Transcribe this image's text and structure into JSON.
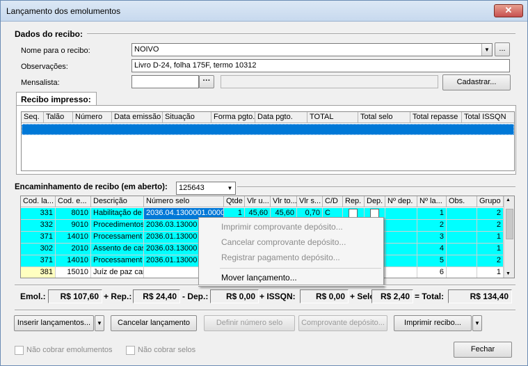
{
  "window": {
    "title": "Lançamento dos emolumentos",
    "close_glyph": "✕"
  },
  "dados": {
    "group_label": "Dados do recibo:",
    "nome_label": "Nome para o recibo:",
    "nome_value": "NOIVO",
    "nome_ellipsis": "...",
    "obs_label": "Observações:",
    "obs_value": "Livro D-24, folha 175F, termo 10312",
    "mensalista_label": "Mensalista:",
    "mensalista_value": "",
    "mensalista_ellipsis": "···",
    "mensalista_name": "",
    "cadastrar_label": "Cadastrar..."
  },
  "recibo_impresso": {
    "tab_label": "Recibo impresso:",
    "columns": [
      "Seq.",
      "Talão",
      "Número",
      "Data emissão",
      "Situação",
      "Forma pgto.",
      "Data pgto.",
      "TOTAL",
      "Total selo",
      "Total repasse",
      "Total ISSQN"
    ]
  },
  "encaminhamento": {
    "label": "Encaminhamento de recibo (em aberto):",
    "value": "125643",
    "columns": [
      "Cod. la...",
      "Cod. e...",
      "Descrição",
      "Número selo",
      "Qtde",
      "Vlr u...",
      "Vlr to...",
      "Vlr s...",
      "C/D",
      "Rep.",
      "Dep.",
      "Nº dep.",
      "Nº la...",
      "Obs.",
      "Grupo"
    ],
    "rows": [
      {
        "cod_la": "331",
        "cod_e": "8010",
        "desc": "Habilitação de",
        "selo": "2036.04.1300001.0000",
        "qtde": "1",
        "vlr_u": "45,60",
        "vlr_to": "45,60",
        "vlr_s": "0,70",
        "cd": "C",
        "n_la": "1",
        "grupo": "2"
      },
      {
        "cod_la": "332",
        "cod_e": "9010",
        "desc": "Procedimentos",
        "selo": "2036.03.13000",
        "qtde": "",
        "vlr_u": "",
        "vlr_to": "",
        "vlr_s": "",
        "cd": "",
        "n_la": "2",
        "grupo": "2"
      },
      {
        "cod_la": "371",
        "cod_e": "14010",
        "desc": "Processament",
        "selo": "2036.01.13000",
        "qtde": "",
        "vlr_u": "",
        "vlr_to": "",
        "vlr_s": "",
        "cd": "",
        "n_la": "3",
        "grupo": "1"
      },
      {
        "cod_la": "302",
        "cod_e": "2010",
        "desc": "Assento de cas",
        "selo": "2036.03.13000",
        "qtde": "",
        "vlr_u": "",
        "vlr_to": "",
        "vlr_s": "",
        "cd": "",
        "n_la": "4",
        "grupo": "1"
      },
      {
        "cod_la": "371",
        "cod_e": "14010",
        "desc": "Processament",
        "selo": "2036.01.13000",
        "qtde": "",
        "vlr_u": "",
        "vlr_to": "",
        "vlr_s": "",
        "cd": "",
        "n_la": "5",
        "grupo": "2"
      },
      {
        "cod_la": "381",
        "cod_e": "15010",
        "desc": "Juíz de paz car",
        "selo": "",
        "qtde": "",
        "vlr_u": "",
        "vlr_to": "",
        "vlr_s": "",
        "cd": "",
        "n_la": "6",
        "grupo": "1"
      }
    ]
  },
  "context_menu": {
    "items": [
      {
        "label": "Imprimir comprovante depósito...",
        "enabled": false
      },
      {
        "label": "Cancelar comprovante depósito...",
        "enabled": false
      },
      {
        "label": "Registrar pagamento depósito...",
        "enabled": false
      },
      {
        "label": "Mover lançamento...",
        "enabled": true
      }
    ]
  },
  "totals": {
    "emol_label": "Emol.:",
    "emol_value": "R$ 107,60",
    "rep_label": "+ Rep.:",
    "rep_value": "R$ 24,40",
    "dep_label": "- Dep.:",
    "dep_value": "R$ 0,00",
    "issqn_label": "+ ISSQN:",
    "issqn_value": "R$ 0,00",
    "selo_label": "+ Selo:",
    "selo_value": "R$ 2,40",
    "total_label": "= Total:",
    "total_value": "R$ 134,40"
  },
  "buttons": {
    "inserir": "Inserir lançamentos...",
    "cancelar": "Cancelar lançamento",
    "definir": "Definir número selo",
    "comprovante": "Comprovante depósito...",
    "imprimir": "Imprimir recibo...",
    "fechar": "Fechar"
  },
  "footer": {
    "nao_cobrar_emol": "Não cobrar emolumentos",
    "nao_cobrar_selos": "Não cobrar selos"
  },
  "colors": {
    "row_highlight": "#00ffff",
    "row_selected": "#0078d7",
    "row_pending": "#ffffc0"
  }
}
